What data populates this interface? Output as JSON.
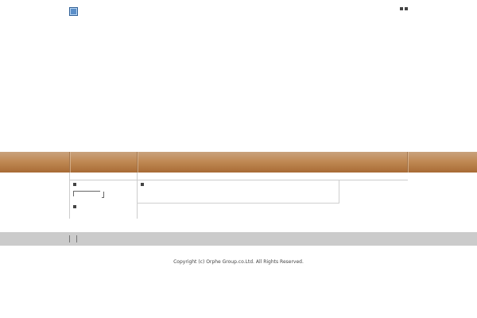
{
  "header": {
    "logo_icon": "small-square-logo-icon",
    "top_right_icons": [
      "square-icon",
      "square-icon"
    ]
  },
  "navigation": {
    "style": "brown gradient bar",
    "color": "#b77a45"
  },
  "main": {
    "left_column_markers": [
      "square-icon",
      "square-icon"
    ],
    "content_marker": "square-icon"
  },
  "footer": {
    "background_color": "#cbcbcb",
    "copyright": "Copyright (c) Orphe Group.co.Ltd. All Rights Reserved."
  }
}
